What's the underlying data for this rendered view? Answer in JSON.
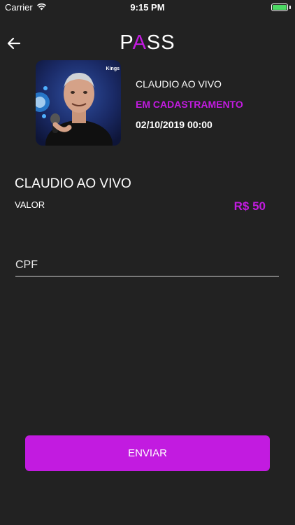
{
  "status_bar": {
    "carrier": "Carrier",
    "time": "9:15 PM"
  },
  "header": {
    "logo_left": "P",
    "logo_accent": "A",
    "logo_right": "SS",
    "accent_color": "#c21be0"
  },
  "event": {
    "name": "CLAUDIO AO VIVO",
    "status": "EM CADASTRAMENTO",
    "datetime": "02/10/2019 00:00",
    "image_text": "Kings"
  },
  "details": {
    "title": "CLAUDIO AO VIVO",
    "valor_label": "VALOR",
    "price": "R$ 50"
  },
  "form": {
    "cpf_placeholder": "CPF"
  },
  "actions": {
    "send_label": "ENVIAR"
  },
  "icons": {
    "back": "arrow-left-icon",
    "wifi": "wifi-icon",
    "battery": "battery-icon"
  }
}
